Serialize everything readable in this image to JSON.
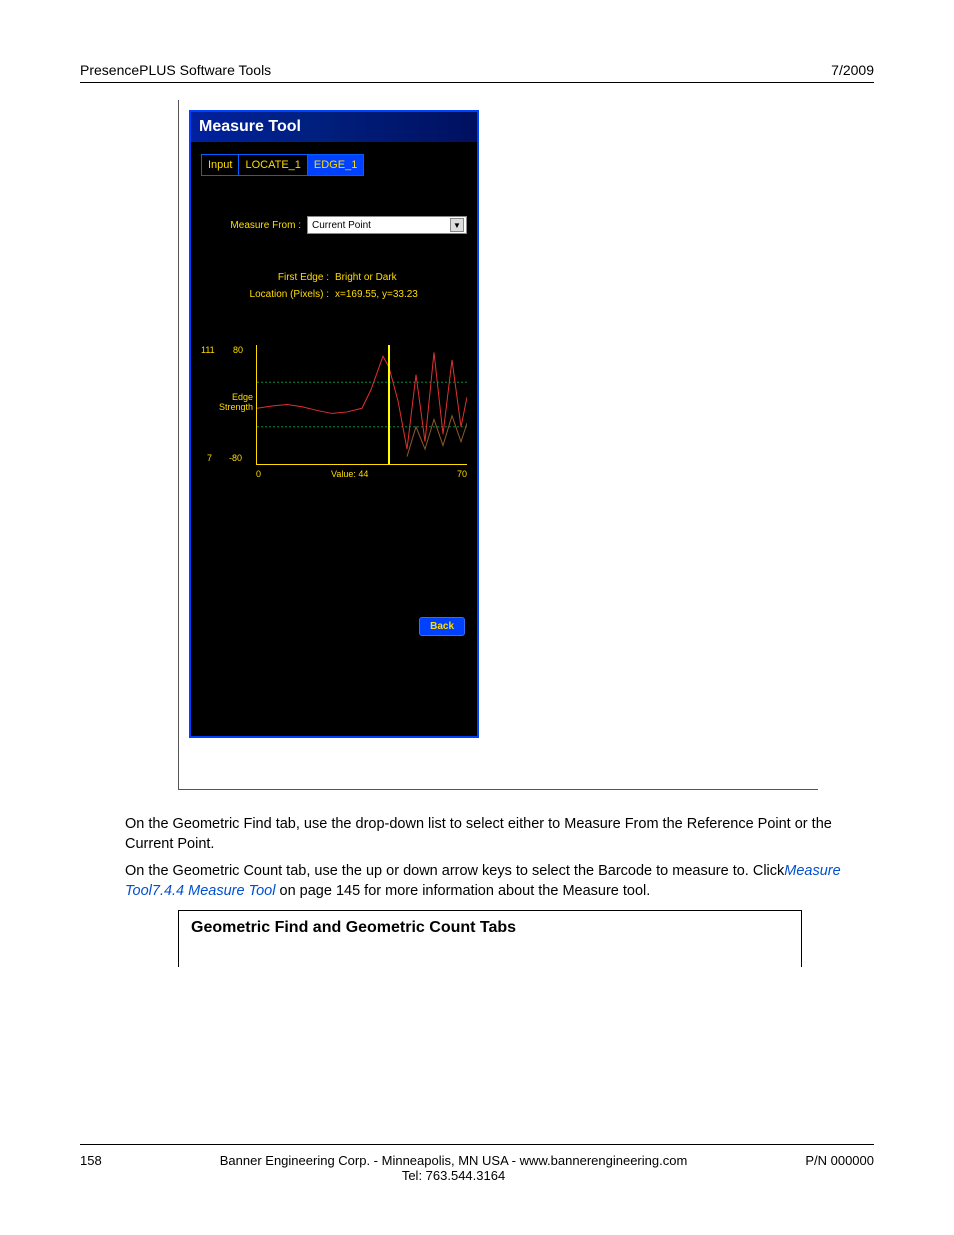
{
  "header": {
    "left": "PresencePLUS Software Tools",
    "right": "7/2009"
  },
  "tool": {
    "title": "Measure Tool",
    "tabs": [
      "Input",
      "LOCATE_1",
      "EDGE_1"
    ],
    "active_tab_index": 2,
    "measure_from_label": "Measure From :",
    "measure_from_value": "Current Point",
    "first_edge_label": "First Edge :",
    "first_edge_value": "Bright or Dark",
    "location_label": "Location (Pixels) :",
    "location_value": "x=169.55, y=33.23",
    "back_label": "Back"
  },
  "chart_data": {
    "type": "line",
    "xlabel_left": "0",
    "xlabel_center": "Value:  44",
    "xlabel_right": "70",
    "ylabel_top_outer": "111",
    "ylabel_top_inner": "80",
    "ylabel_bot_outer": "7",
    "ylabel_bot_inner": "-80",
    "axis_title": "Edge\nStrength",
    "ylim": [
      -80,
      80
    ],
    "xlim": [
      0,
      70
    ],
    "marker_x": 44,
    "thresholds": [
      30,
      -30
    ],
    "series": [
      {
        "name": "red",
        "x": [
          0,
          5,
          10,
          15,
          20,
          25,
          30,
          35,
          38,
          42,
          44,
          47,
          50,
          53,
          56,
          59,
          62,
          65,
          68,
          70
        ],
        "values": [
          -5,
          -2,
          0,
          -3,
          -8,
          -12,
          -10,
          -5,
          20,
          65,
          50,
          5,
          -60,
          40,
          -50,
          70,
          -40,
          60,
          -30,
          10
        ]
      },
      {
        "name": "brown",
        "x": [
          50,
          53,
          56,
          59,
          62,
          65,
          68,
          70
        ],
        "values": [
          -70,
          -30,
          -60,
          -20,
          -55,
          -15,
          -50,
          -25
        ]
      }
    ]
  },
  "paragraphs": {
    "p1": "On the Geometric Find tab, use the drop-down list to select either to Measure From the Reference Point or the Current Point.",
    "p2_a": "On the Geometric Count tab, use the up or down arrow keys to select the Barcode to measure to. Click",
    "p2_link": "Measure Tool7.4.4 Measure Tool",
    "p2_b": " on page 145 for more information about the Measure tool."
  },
  "subsection": {
    "title": "Geometric Find and Geometric Count Tabs"
  },
  "footer": {
    "page": "158",
    "center1": "Banner Engineering Corp. - Minneapolis, MN USA - www.bannerengineering.com",
    "center2": "Tel: 763.544.3164",
    "right": "P/N 000000"
  }
}
